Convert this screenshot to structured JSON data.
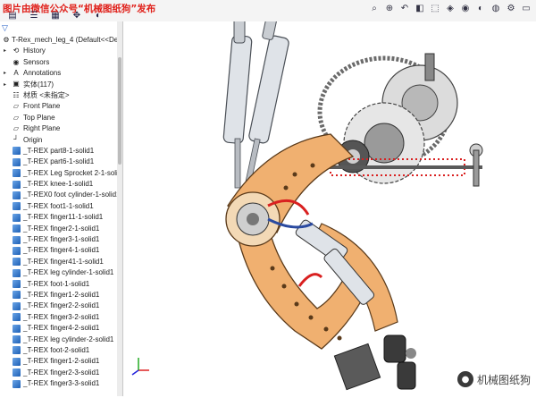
{
  "watermark": "图片由微信公众号“机械图纸狗”发布",
  "manager_tabs": [
    "feature-manager",
    "property-manager",
    "configuration-manager",
    "dimxpert",
    "display-manager"
  ],
  "view_toolbar": [
    "zoom-fit",
    "zoom-area",
    "previous-view",
    "section-view",
    "view-orientation",
    "display-style",
    "hide-show",
    "edit-appearance",
    "apply-scene",
    "view-settings",
    "monitor"
  ],
  "tree": {
    "root": "T-Rex_mech_leg_4  (Default<<Defau",
    "items": [
      {
        "label": "History",
        "icon": "history-icon",
        "exp": "▸"
      },
      {
        "label": "Sensors",
        "icon": "sensor-icon",
        "exp": ""
      },
      {
        "label": "Annotations",
        "icon": "annotation-icon",
        "exp": "▸"
      },
      {
        "label": "实体(117)",
        "icon": "solid-bodies-icon",
        "exp": "▸"
      },
      {
        "label": "材质 <未指定>",
        "icon": "material-icon",
        "exp": ""
      },
      {
        "label": "Front Plane",
        "icon": "plane-icon",
        "exp": ""
      },
      {
        "label": "Top Plane",
        "icon": "plane-icon",
        "exp": ""
      },
      {
        "label": "Right Plane",
        "icon": "plane-icon",
        "exp": ""
      },
      {
        "label": "Origin",
        "icon": "origin-icon",
        "exp": ""
      },
      {
        "label": "_T-REX part8-1-solid1",
        "icon": "part-icon",
        "exp": ""
      },
      {
        "label": "_T-REX part6-1-solid1",
        "icon": "part-icon",
        "exp": ""
      },
      {
        "label": "_T-REX Leg Sprocket 2-1-solid1",
        "icon": "part-icon",
        "exp": ""
      },
      {
        "label": "_T-REX knee-1-solid1",
        "icon": "part-icon",
        "exp": ""
      },
      {
        "label": "_T-REX0 foot cylinder-1-solid1",
        "icon": "part-icon",
        "exp": ""
      },
      {
        "label": "_T-REX foot1-1-solid1",
        "icon": "part-icon",
        "exp": ""
      },
      {
        "label": "_T-REX finger11-1-solid1",
        "icon": "part-icon",
        "exp": ""
      },
      {
        "label": "_T-REX finger2-1-solid1",
        "icon": "part-icon",
        "exp": ""
      },
      {
        "label": "_T-REX finger3-1-solid1",
        "icon": "part-icon",
        "exp": ""
      },
      {
        "label": "_T-REX finger4-1-solid1",
        "icon": "part-icon",
        "exp": ""
      },
      {
        "label": "_T-REX finger41-1-solid1",
        "icon": "part-icon",
        "exp": ""
      },
      {
        "label": "_T-REX leg cylinder-1-solid1",
        "icon": "part-icon",
        "exp": ""
      },
      {
        "label": "_T-REX foot-1-solid1",
        "icon": "part-icon",
        "exp": ""
      },
      {
        "label": "_T-REX finger1-2-solid1",
        "icon": "part-icon",
        "exp": ""
      },
      {
        "label": "_T-REX finger2-2-solid1",
        "icon": "part-icon",
        "exp": ""
      },
      {
        "label": "_T-REX finger3-2-solid1",
        "icon": "part-icon",
        "exp": ""
      },
      {
        "label": "_T-REX finger4-2-solid1",
        "icon": "part-icon",
        "exp": ""
      },
      {
        "label": "_T-REX leg cylinder-2-solid1",
        "icon": "part-icon",
        "exp": ""
      },
      {
        "label": "_T-REX foot-2-solid1",
        "icon": "part-icon",
        "exp": ""
      },
      {
        "label": "_T-REX finger1-2-solid1",
        "icon": "part-icon",
        "exp": ""
      },
      {
        "label": "_T-REX finger2-3-solid1",
        "icon": "part-icon",
        "exp": ""
      },
      {
        "label": "_T-REX finger3-3-solid1",
        "icon": "part-icon",
        "exp": ""
      }
    ]
  },
  "brand": "机械图纸狗",
  "colors": {
    "frame": "#f0b070",
    "frame_edge": "#5a3a1a",
    "spring": "#d92020",
    "watermark": "#e0201a"
  }
}
